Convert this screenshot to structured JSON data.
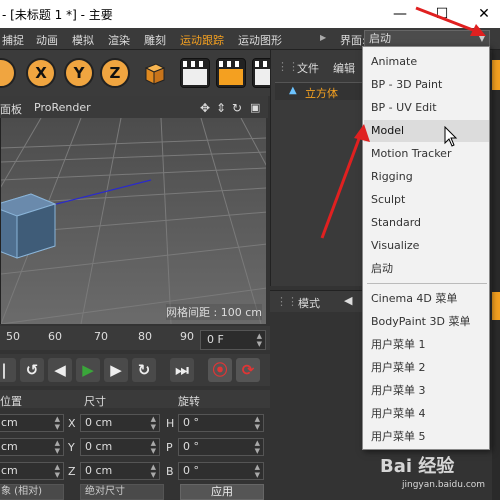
{
  "window": {
    "title": "- [未标题 1 *] - 主要",
    "minimize": "—",
    "maximize": "☐",
    "close": "✕"
  },
  "menubar": {
    "items": [
      "捕捉",
      "动画",
      "模拟",
      "渲染",
      "雕刻",
      "运动跟踪",
      "运动图形"
    ],
    "active_index": 5,
    "layout_label": "界面:",
    "layout_value": "启动"
  },
  "toolbar": {
    "axes": [
      "X",
      "Y",
      "Z"
    ]
  },
  "viewport": {
    "menu": [
      "面板",
      "ProRender"
    ],
    "grid_spacing": "网格间距 : 100 cm"
  },
  "timeline": {
    "ticks": [
      "50",
      "60",
      "70",
      "80",
      "90"
    ],
    "current_frame": "0 F"
  },
  "coordinates": {
    "headers": [
      "位置",
      "尺寸",
      "旋转"
    ],
    "rows": [
      {
        "pos": "cm",
        "size_axis": "X",
        "size": "0 cm",
        "rot_axis": "H",
        "rot": "0 °"
      },
      {
        "pos": "cm",
        "size_axis": "Y",
        "size": "0 cm",
        "rot_axis": "P",
        "rot": "0 °"
      },
      {
        "pos": "cm",
        "size_axis": "Z",
        "size": "0 cm",
        "rot_axis": "B",
        "rot": "0 °"
      }
    ],
    "mode": "象 (相对)",
    "size_mode": "绝对尺寸",
    "apply": "应用"
  },
  "object_manager": {
    "tabs": [
      "文件",
      "编辑"
    ],
    "objects": [
      {
        "name": "立方体"
      }
    ]
  },
  "attribute_manager": {
    "mode_label": "模式"
  },
  "dropdown": {
    "items": [
      "Animate",
      "BP - 3D Paint",
      "BP - UV Edit",
      "Model",
      "Motion Tracker",
      "Rigging",
      "Sculpt",
      "Standard",
      "Visualize",
      "启动",
      "Cinema 4D 菜单",
      "BodyPaint 3D 菜单",
      "用户菜单 1",
      "用户菜单 2",
      "用户菜单 3",
      "用户菜单 4",
      "用户菜单 5"
    ],
    "hovered": "Model"
  },
  "watermark": {
    "text": "Bai 经验",
    "sub": "jingyan.baidu.com"
  },
  "colors": {
    "accent": "#f4a020",
    "annotation_arrow": "#e02020"
  }
}
